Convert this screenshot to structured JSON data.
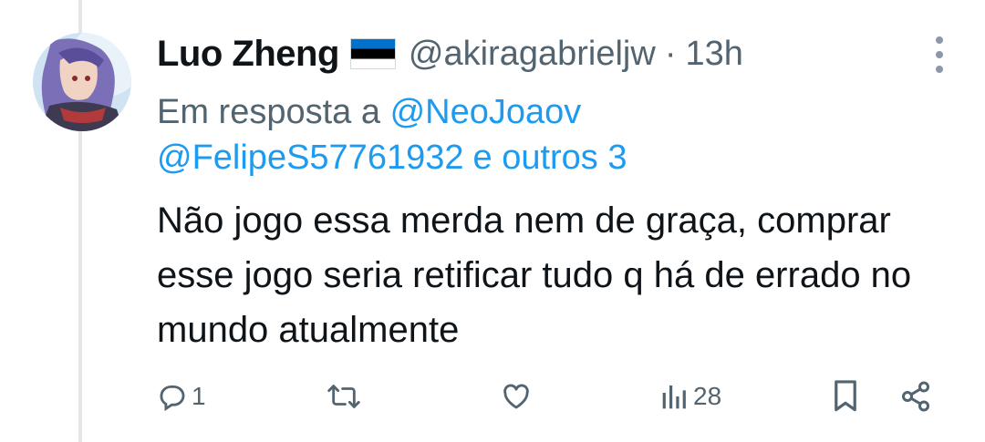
{
  "tweet": {
    "author_name": "Luo Zheng",
    "handle": "@akiragabrieljw",
    "separator": "·",
    "time": "13h",
    "reply_prefix": "Em resposta a",
    "mention_primary": "@NeoJoaov",
    "mention_secondary": "@FelipeS57761932",
    "others_text": "e outros 3",
    "body": "Não jogo essa merda nem de graça, comprar esse jogo seria retificar tudo q há de errado no mundo atualmente",
    "flag": "estonia-flag"
  },
  "actions": {
    "reply_count": "1",
    "retweet_count": "",
    "like_count": "",
    "view_count": "28"
  },
  "colors": {
    "link": "#1d9bf0",
    "muted": "#536471",
    "text": "#0f1419",
    "thread_line": "#e6e6e6"
  }
}
